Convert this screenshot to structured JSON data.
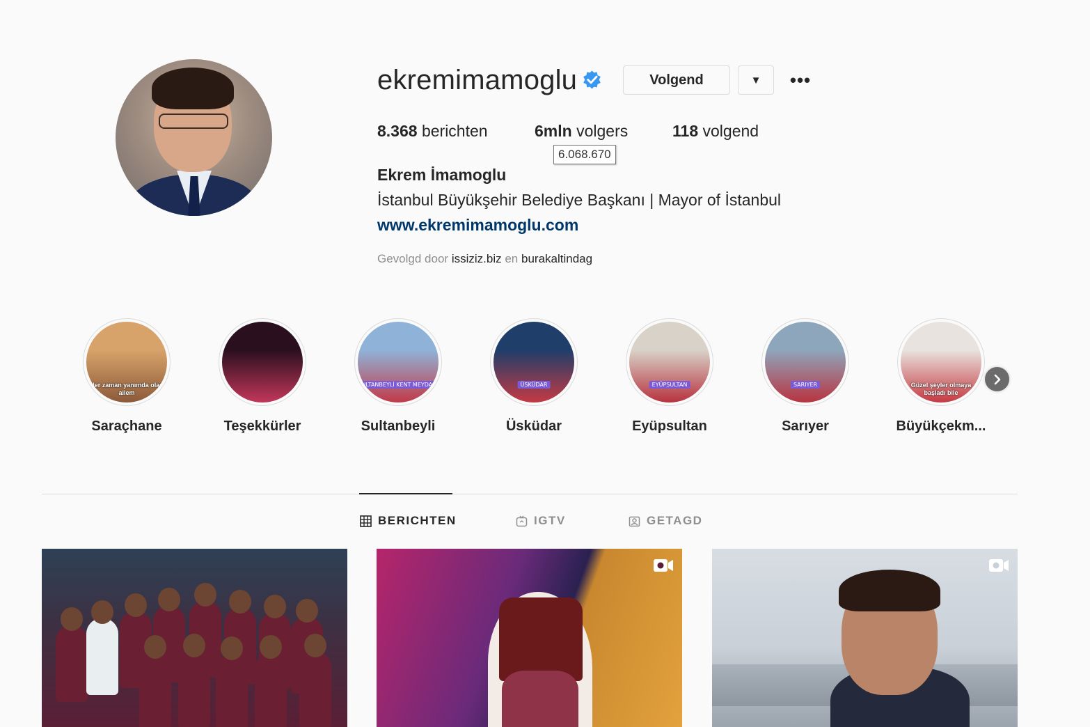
{
  "profile": {
    "username": "ekremimamoglu",
    "verified": true,
    "follow_button": "Volgend",
    "dropdown_glyph": "▼",
    "more_glyph": "•••",
    "stats": {
      "posts_count": "8.368",
      "posts_label": "berichten",
      "followers_count": "6mln",
      "followers_label": "volgers",
      "followers_tooltip": "6.068.670",
      "following_count": "118",
      "following_label": "volgend"
    },
    "full_name": "Ekrem İmamoglu",
    "bio": "İstanbul Büyükşehir Belediye Başkanı | Mayor of İstanbul",
    "website": "www.ekremimamoglu.com",
    "followed_by": {
      "prefix": "Gevolgd door",
      "user1": "issiziz.biz",
      "conjunction": "en",
      "user2": "burakaltindag"
    }
  },
  "highlights": [
    {
      "label": "Saraçhane",
      "caption": "Her zaman yanımda olan ailem",
      "colors": [
        "#d7a36a",
        "#8c5a3a"
      ]
    },
    {
      "label": "Teşekkürler",
      "caption": "",
      "colors": [
        "#2a0f1e",
        "#c2375a"
      ]
    },
    {
      "label": "Sultanbeyli",
      "tag": "SULTANBEYLİ KENT MEYDANI",
      "colors": [
        "#8fb3d8",
        "#c23a48"
      ]
    },
    {
      "label": "Üsküdar",
      "tag": "ÜSKÜDAR",
      "colors": [
        "#1f3e6a",
        "#c43a44"
      ]
    },
    {
      "label": "Eyüpsultan",
      "tag": "EYÜPSULTAN",
      "colors": [
        "#d8d2c8",
        "#b7323e"
      ]
    },
    {
      "label": "Sarıyer",
      "tag": "SARIYER",
      "colors": [
        "#8ea6bc",
        "#b83340"
      ]
    },
    {
      "label": "Büyükçekm...",
      "caption": "Güzel şeyler olmaya başladı bile",
      "colors": [
        "#e8e3de",
        "#c53a42"
      ]
    }
  ],
  "highlights_next_icon": "chevron-right-icon",
  "tabs": [
    {
      "label": "BERICHTEN",
      "icon": "grid-icon",
      "active": true
    },
    {
      "label": "IGTV",
      "icon": "igtv-icon",
      "active": false
    },
    {
      "label": "GETAGD",
      "icon": "tagged-icon",
      "active": false
    }
  ],
  "posts": [
    {
      "type": "photo",
      "subject": "football-team"
    },
    {
      "type": "video",
      "subject": "ataturk-illustration"
    },
    {
      "type": "video",
      "subject": "portrait"
    }
  ],
  "colors": {
    "link": "#00376b",
    "verified": "#3897f0",
    "text": "#262626",
    "muted": "#8e8e8e",
    "border": "#dbdbdb"
  }
}
